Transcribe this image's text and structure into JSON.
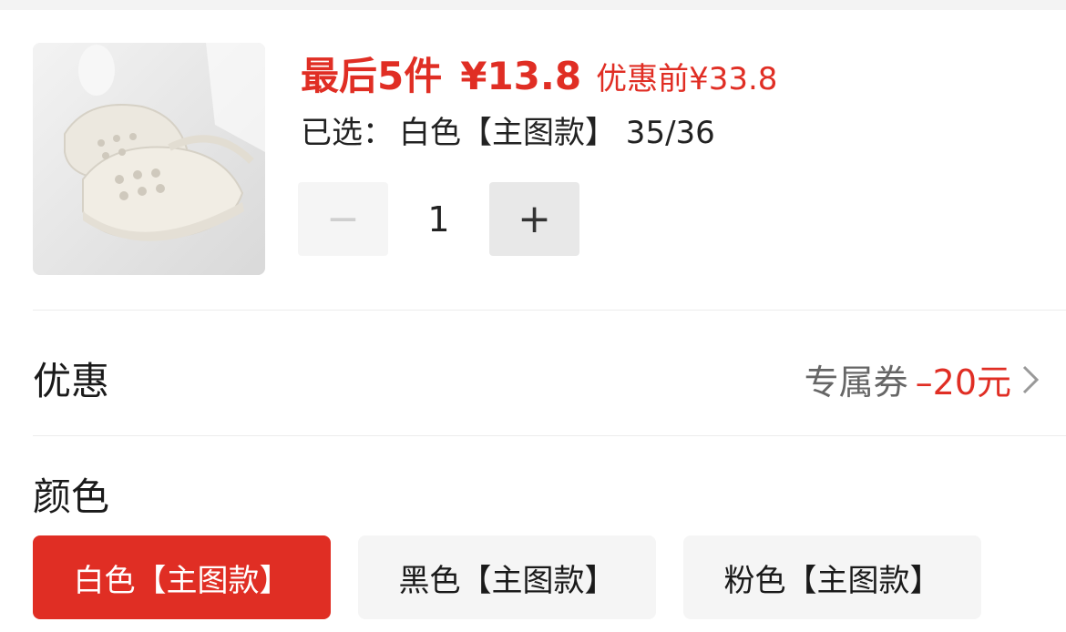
{
  "product": {
    "image_icon": "white-clog-sandals-image",
    "stock_label": "最后5件",
    "price": "¥13.8",
    "original_price": "优惠前¥33.8",
    "selected_prefix": "已选：",
    "selected_value": "白色【主图款】 35/36"
  },
  "quantity": {
    "minus_label": "−",
    "value": "1",
    "plus_label": "+"
  },
  "discount": {
    "title": "优惠",
    "coupon_label": "专属券",
    "coupon_amount": "–20元",
    "chevron_icon": "chevron-right-icon"
  },
  "color": {
    "title": "颜色",
    "options": [
      {
        "label": "白色【主图款】",
        "selected": true
      },
      {
        "label": "黑色【主图款】",
        "selected": false
      },
      {
        "label": "粉色【主图款】",
        "selected": false
      }
    ]
  },
  "colors": {
    "accent": "#e02e24",
    "muted_text": "#666666",
    "option_bg": "#f5f5f5"
  }
}
